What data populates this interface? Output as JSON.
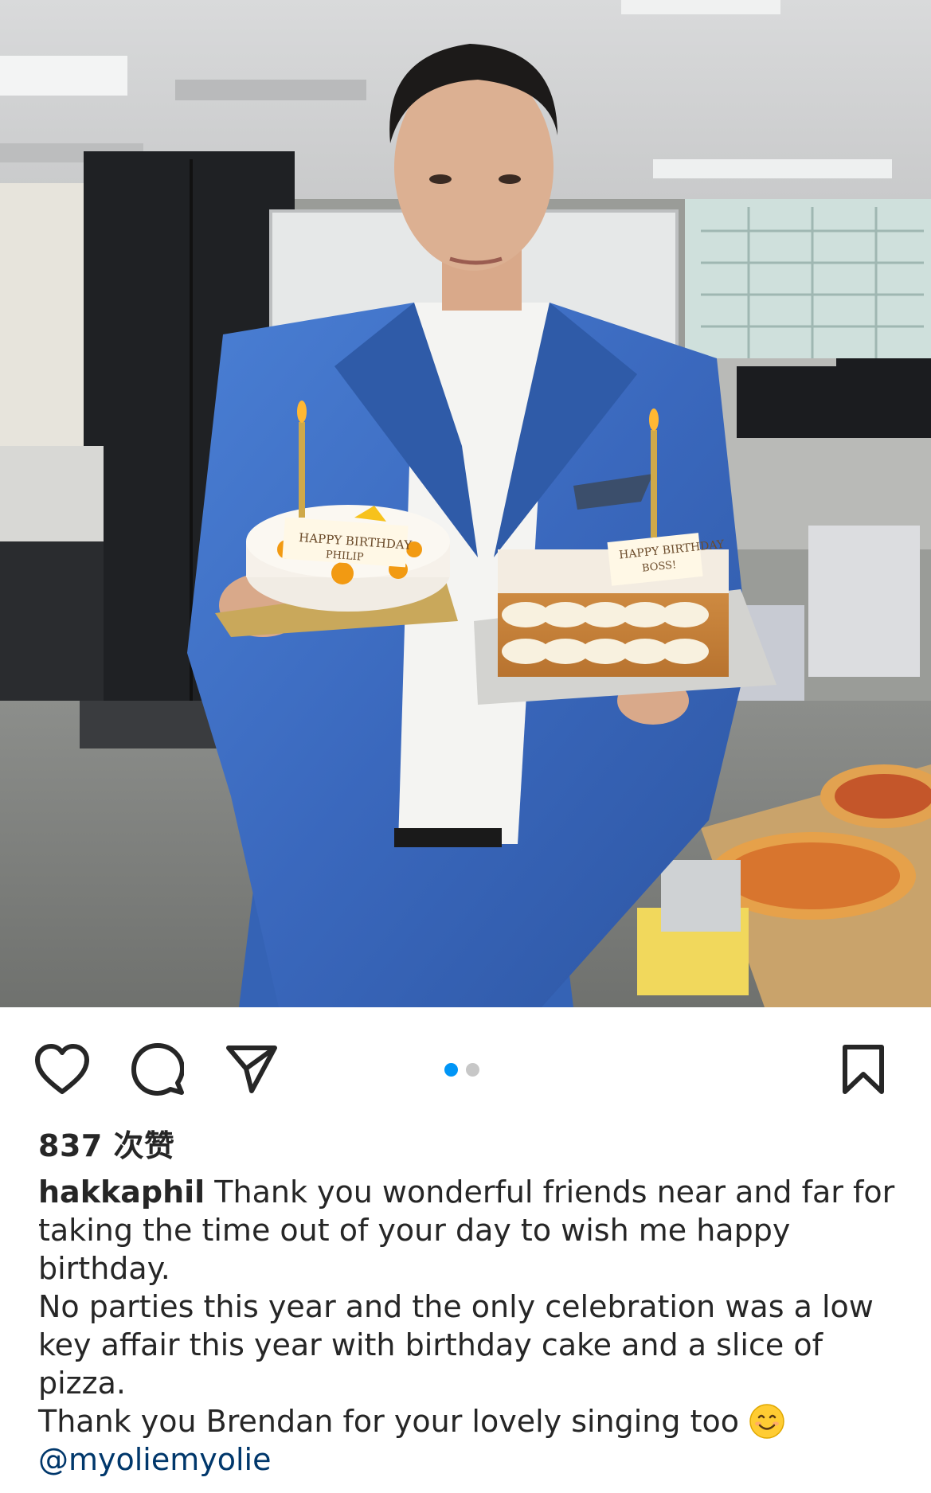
{
  "post": {
    "image_alt": "Man in blue suit holding two birthday cakes in an office",
    "carousel": {
      "total": 2,
      "active_index": 0
    },
    "cake_left_text": "HAPPY BIRTHDAY PHILIP",
    "cake_right_text": "HAPPY BIRTHDAY BOSS!"
  },
  "actions": {
    "like_icon": "heart-icon",
    "comment_icon": "comment-icon",
    "share_icon": "paper-plane-icon",
    "save_icon": "bookmark-icon"
  },
  "likes": {
    "text": "837 次赞"
  },
  "caption": {
    "username": "hakkaphil",
    "line1": "Thank you wonderful friends near and far for taking the time out of your day to wish me happy birthday.",
    "line2": "No parties this year and the only celebration was a low key affair this year with birthday cake and a slice of pizza.",
    "line3": "Thank you Brendan for your lovely singing too",
    "emoji": "smiling-face-emoji",
    "mention": "@myoliemyolie"
  },
  "colors": {
    "accent": "#0095f6",
    "text": "#262626",
    "mention": "#00376b",
    "suit": "#3b6fc4"
  }
}
